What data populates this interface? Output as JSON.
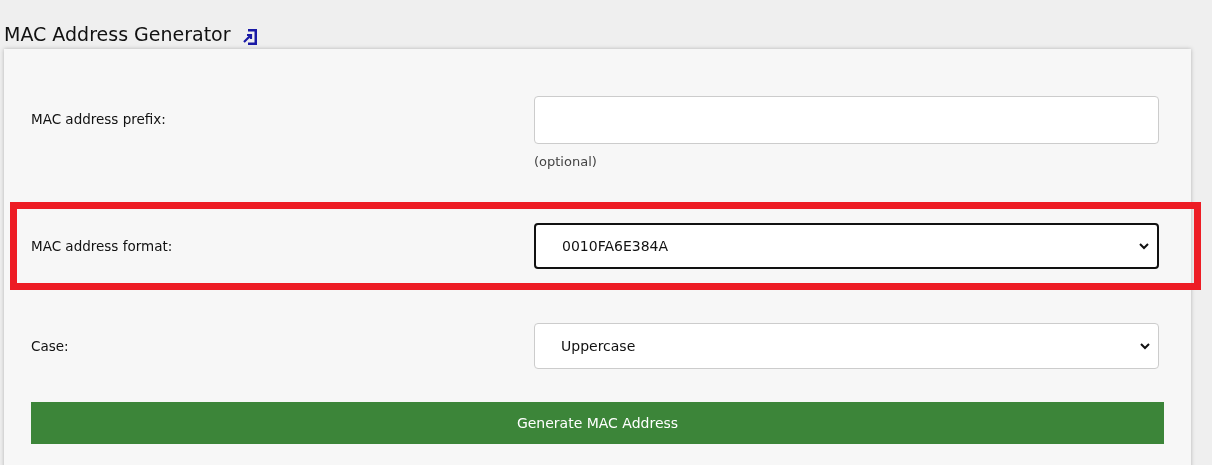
{
  "title": "MAC Address Generator",
  "fields": [
    {
      "kind": "input",
      "label": "MAC address prefix:",
      "hint": "(optional)",
      "highlighted": false,
      "focused": false
    },
    {
      "kind": "select",
      "label": "MAC address format:",
      "value": "0010FA6E384A",
      "highlighted": true,
      "focused": true
    },
    {
      "kind": "select",
      "label": "Case:",
      "value": "Uppercase",
      "highlighted": false,
      "focused": false
    }
  ],
  "button": "Generate MAC Address"
}
